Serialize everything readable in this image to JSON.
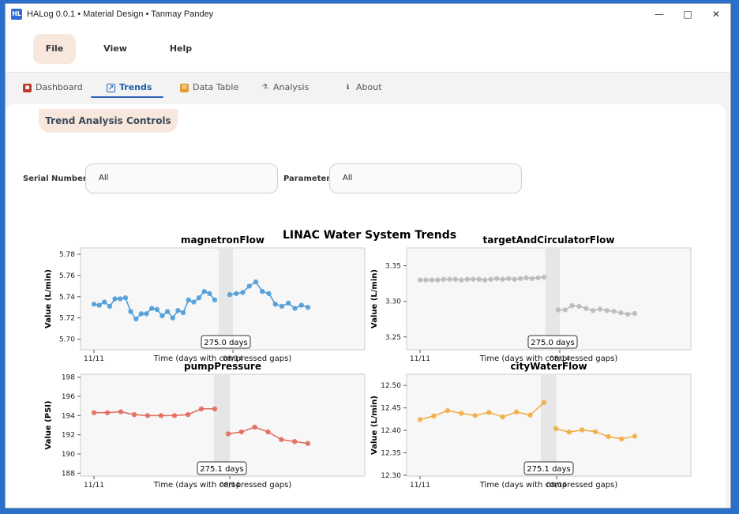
{
  "window": {
    "title": "HALog 0.0.1 • Material Design • Tanmay Pandey",
    "app_icon": "HL",
    "controls": [
      "—",
      "□",
      "✕"
    ]
  },
  "menu": {
    "file": "File",
    "view": "View",
    "help": "Help"
  },
  "tabs": [
    {
      "label": "Dashboard",
      "icon": "dashboard-icon",
      "icon_color": "#c0392b"
    },
    {
      "label": "Trends",
      "icon": "trend-icon",
      "icon_color": "#2b62b8"
    },
    {
      "label": "Data Table",
      "icon": "table-icon",
      "icon_color": "#e09c2a"
    },
    {
      "label": "Analysis",
      "icon": "microscope-icon",
      "icon_color": "#6b6b6b"
    },
    {
      "label": "About",
      "icon": "info-icon",
      "icon_color": "#444444"
    }
  ],
  "controls": {
    "header": "Trend Analysis Controls",
    "serial_label": "Serial Number:",
    "serial_value": "All",
    "param_label": "Parameter:",
    "param_value": "All"
  },
  "colors": {
    "accent": "#2b62b8",
    "menu_highlight": "#f8e7dc"
  },
  "figure_title": "LINAC Water System Trends",
  "chart_data": [
    {
      "type": "line",
      "title": "magnetronFlow",
      "xlabel": "Time (days with compressed gaps)",
      "ylabel": "Value (L/min)",
      "color": "#4a9ad6",
      "ylim": [
        5.69,
        5.786
      ],
      "yticks": [
        5.7,
        5.72,
        5.74,
        5.76,
        5.78
      ],
      "ytick_labels": [
        "5.70",
        "5.72",
        "5.74",
        "5.76",
        "5.78"
      ],
      "xtick_labels": [
        "11/11",
        "08/14"
      ],
      "gap_label": "275.0 days",
      "series": [
        {
          "segment": 1,
          "values": [
            5.733,
            5.732,
            5.735,
            5.731,
            5.738,
            5.738,
            5.739,
            5.726,
            5.719,
            5.724,
            5.724,
            5.729,
            5.728,
            5.722,
            5.726,
            5.72,
            5.727,
            5.725,
            5.737,
            5.735,
            5.739,
            5.745,
            5.743,
            5.737
          ]
        },
        {
          "segment": 2,
          "values": [
            5.742,
            5.743,
            5.744,
            5.75,
            5.754,
            5.745,
            5.743,
            5.733,
            5.731,
            5.734,
            5.729,
            5.732,
            5.73
          ]
        }
      ]
    },
    {
      "type": "line",
      "title": "targetAndCirculatorFlow",
      "xlabel": "Time (days with compressed gaps)",
      "ylabel": "Value (L/min)",
      "color": "#b9b9b9",
      "ylim": [
        3.232,
        3.375
      ],
      "yticks": [
        3.25,
        3.3,
        3.35
      ],
      "ytick_labels": [
        "3.25",
        "3.30",
        "3.35"
      ],
      "xtick_labels": [
        "11/11",
        "08/14"
      ],
      "gap_label": "275.0 days",
      "series": [
        {
          "segment": 1,
          "values": [
            3.33,
            3.33,
            3.33,
            3.33,
            3.331,
            3.331,
            3.331,
            3.33,
            3.331,
            3.331,
            3.331,
            3.33,
            3.331,
            3.332,
            3.331,
            3.332,
            3.331,
            3.332,
            3.333,
            3.332,
            3.333,
            3.334
          ]
        },
        {
          "segment": 2,
          "values": [
            3.288,
            3.288,
            3.294,
            3.293,
            3.29,
            3.287,
            3.289,
            3.287,
            3.286,
            3.284,
            3.282,
            3.283
          ]
        }
      ]
    },
    {
      "type": "line",
      "title": "pumpPressure",
      "xlabel": "Time (days with compressed gaps)",
      "ylabel": "Value (PSI)",
      "color": "#e2675a",
      "ylim": [
        187.7,
        198.3
      ],
      "yticks": [
        188,
        190,
        192,
        194,
        196,
        198
      ],
      "ytick_labels": [
        "188",
        "190",
        "192",
        "194",
        "196",
        "198"
      ],
      "xtick_labels": [
        "11/11",
        "08/14"
      ],
      "gap_label": "275.1 days",
      "series": [
        {
          "segment": 1,
          "values": [
            194.3,
            194.3,
            194.4,
            194.1,
            194.0,
            194.0,
            194.0,
            194.1,
            194.7,
            194.7
          ]
        },
        {
          "segment": 2,
          "values": [
            192.1,
            192.3,
            192.8,
            192.3,
            191.5,
            191.3,
            191.1
          ]
        }
      ]
    },
    {
      "type": "line",
      "title": "cityWaterFlow",
      "xlabel": "Time (days with compressed gaps)",
      "ylabel": "Value (L/min)",
      "color": "#f0ab3c",
      "ylim": [
        12.298,
        12.525
      ],
      "yticks": [
        12.3,
        12.35,
        12.4,
        12.45,
        12.5
      ],
      "ytick_labels": [
        "12.30",
        "12.35",
        "12.40",
        "12.45",
        "12.50"
      ],
      "xtick_labels": [
        "11/11",
        "08/14"
      ],
      "gap_label": "275.1 days",
      "series": [
        {
          "segment": 1,
          "values": [
            12.424,
            12.432,
            12.444,
            12.438,
            12.433,
            12.44,
            12.43,
            12.441,
            12.434,
            12.462
          ]
        },
        {
          "segment": 2,
          "values": [
            12.404,
            12.396,
            12.401,
            12.397,
            12.386,
            12.381,
            12.387
          ]
        }
      ]
    }
  ]
}
